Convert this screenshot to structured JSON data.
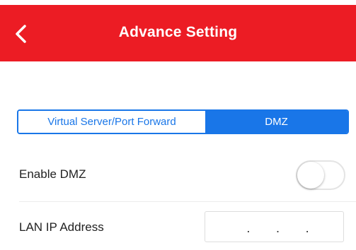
{
  "header": {
    "title": "Advance Setting",
    "bg_color": "#ec1c24",
    "back_icon": "chevron-left-icon"
  },
  "tabs": [
    {
      "label": "Virtual Server/Port Forward",
      "selected": false
    },
    {
      "label": "DMZ",
      "selected": true
    }
  ],
  "accent_color": "#1976e8",
  "dmz": {
    "label": "Enable DMZ",
    "enabled": false
  },
  "lan_ip": {
    "label": "LAN IP Address",
    "separators": [
      ".",
      ".",
      "."
    ]
  }
}
